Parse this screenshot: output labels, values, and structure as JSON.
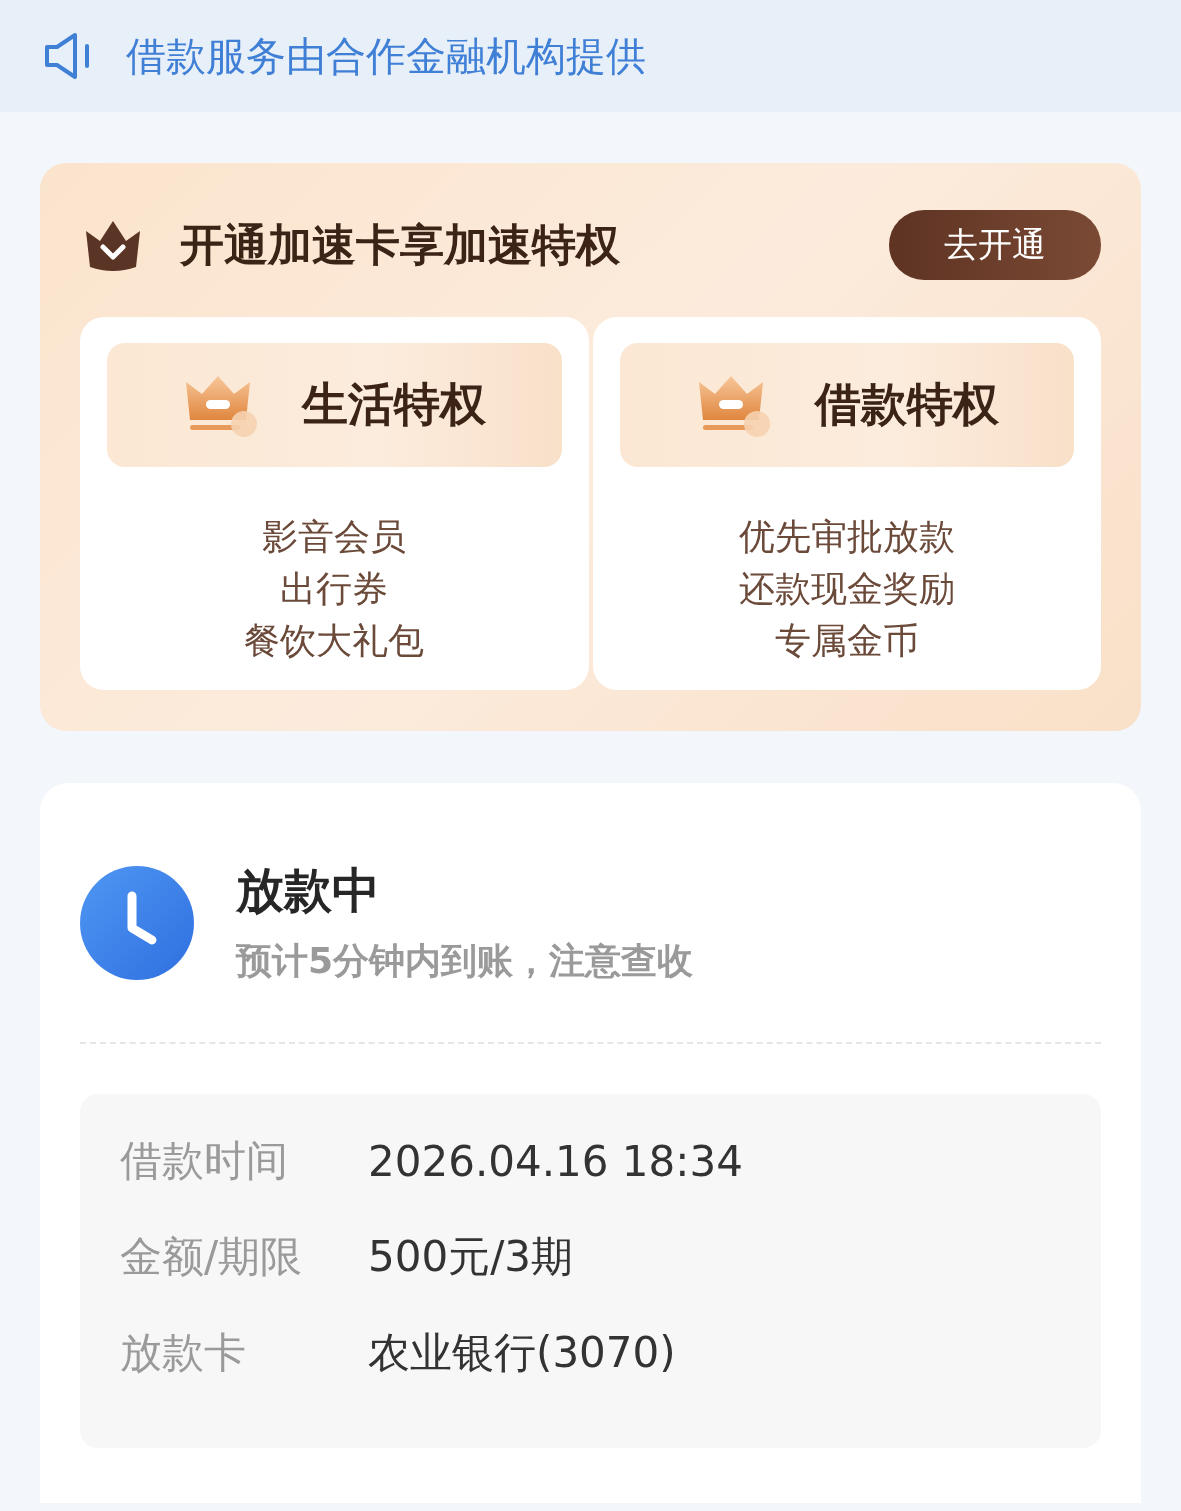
{
  "notice": {
    "text": "借款服务由合作金融机构提供"
  },
  "promo": {
    "title": "开通加速卡享加速特权",
    "button": "去开通",
    "panels": [
      {
        "title": "生活特权",
        "items": [
          "影音会员",
          "出行券",
          "餐饮大礼包"
        ]
      },
      {
        "title": "借款特权",
        "items": [
          "优先审批放款",
          "还款现金奖励",
          "专属金币"
        ]
      }
    ]
  },
  "status": {
    "title": "放款中",
    "subtitle": "预计5分钟内到账，注意查收",
    "details": [
      {
        "label": "借款时间",
        "value": "2026.04.16 18:34"
      },
      {
        "label": "金额/期限",
        "value": "500元/3期"
      },
      {
        "label": "放款卡",
        "value": "农业银行(3070)"
      }
    ]
  }
}
